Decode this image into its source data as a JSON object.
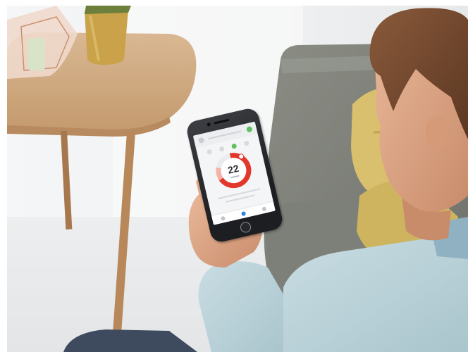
{
  "thermostat_app": {
    "temperature": "22",
    "dial_fill_fraction": 0.69,
    "colors": {
      "dial_active": "#e2372b",
      "dial_inactive": "#e9ebee",
      "status_ok": "#5fbf5a",
      "tab_active": "#2f7fd6"
    },
    "icons": [
      "menu-icon",
      "status-icon",
      "mode-icon"
    ]
  }
}
